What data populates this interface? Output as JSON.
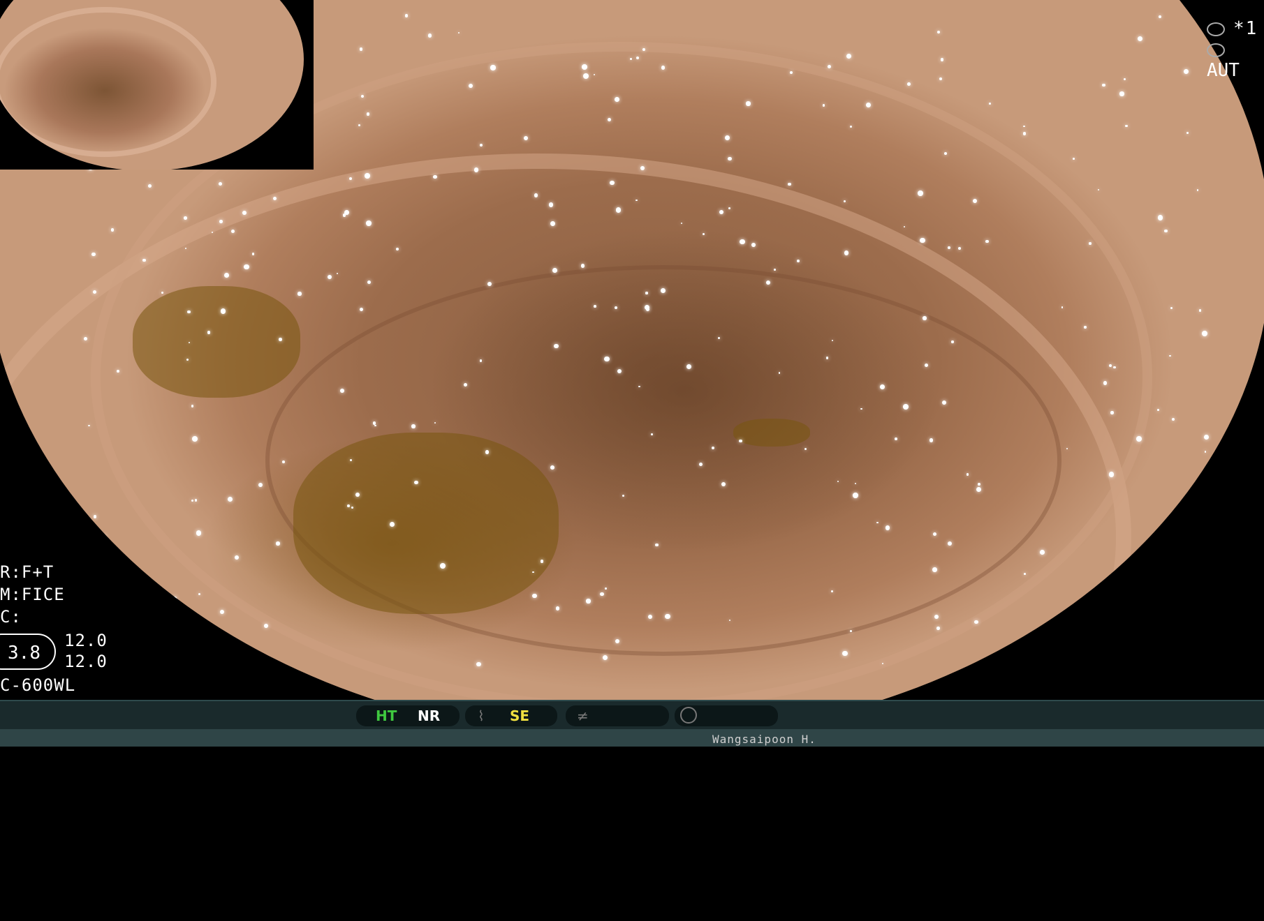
{
  "top_right": {
    "line1_text": "1",
    "line2_text": "AUT"
  },
  "info": {
    "line1": "R:F+T",
    "line2": "M:FICE",
    "line3": "C:",
    "iris_value": "3.8",
    "value_a": "12.0",
    "value_b": "12.0",
    "model": "C-600WL"
  },
  "status_bar": {
    "ht_label": "HT",
    "nr_label": "NR",
    "se_label": "SE",
    "ht_color": "#3fc83f",
    "se_color": "#f0e040"
  },
  "operator": "Wangsaipoon H."
}
